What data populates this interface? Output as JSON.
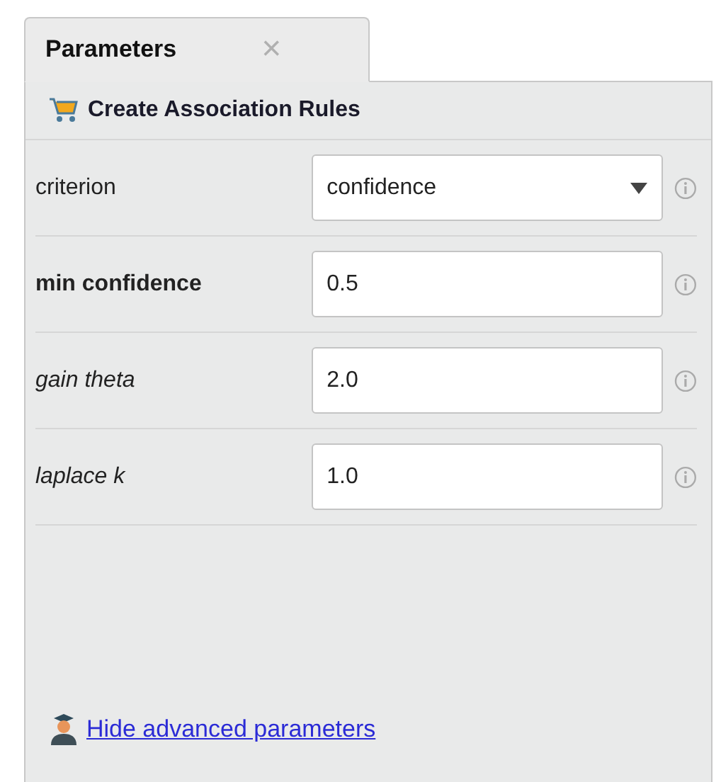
{
  "tab": {
    "label": "Parameters",
    "close": "×",
    "selected": true
  },
  "operator": {
    "title": "Create Association Rules"
  },
  "parameters": [
    {
      "label": "criterion",
      "bold": false,
      "italic": false,
      "kind": "dropdown",
      "value": "confidence"
    },
    {
      "label": "min confidence",
      "bold": true,
      "italic": false,
      "kind": "text",
      "value": "0.5"
    },
    {
      "label": "gain theta",
      "bold": false,
      "italic": true,
      "kind": "text",
      "value": "2.0"
    },
    {
      "label": "laplace k",
      "bold": false,
      "italic": true,
      "kind": "text",
      "value": "1.0"
    }
  ],
  "footer": {
    "link": "Hide advanced parameters"
  }
}
